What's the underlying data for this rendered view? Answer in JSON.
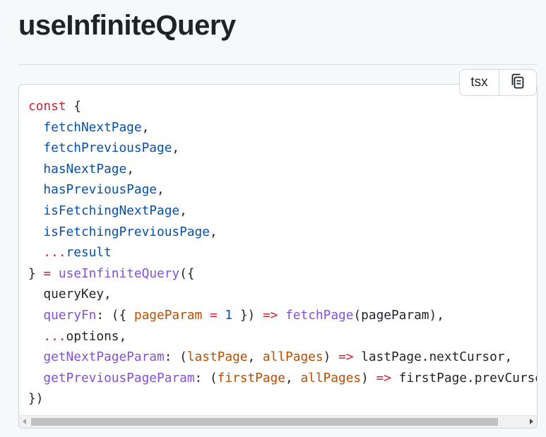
{
  "page": {
    "title": "useInfiniteQuery"
  },
  "code_block": {
    "language": "tsx",
    "copy_icon": "copy-icon",
    "lines": [
      [
        {
          "t": "kw",
          "v": "const"
        },
        {
          "t": "p",
          "v": " {"
        }
      ],
      [
        {
          "t": "p",
          "v": "  "
        },
        {
          "t": "prop",
          "v": "fetchNextPage"
        },
        {
          "t": "p",
          "v": ","
        }
      ],
      [
        {
          "t": "p",
          "v": "  "
        },
        {
          "t": "prop",
          "v": "fetchPreviousPage"
        },
        {
          "t": "p",
          "v": ","
        }
      ],
      [
        {
          "t": "p",
          "v": "  "
        },
        {
          "t": "prop",
          "v": "hasNextPage"
        },
        {
          "t": "p",
          "v": ","
        }
      ],
      [
        {
          "t": "p",
          "v": "  "
        },
        {
          "t": "prop",
          "v": "hasPreviousPage"
        },
        {
          "t": "p",
          "v": ","
        }
      ],
      [
        {
          "t": "p",
          "v": "  "
        },
        {
          "t": "prop",
          "v": "isFetchingNextPage"
        },
        {
          "t": "p",
          "v": ","
        }
      ],
      [
        {
          "t": "p",
          "v": "  "
        },
        {
          "t": "prop",
          "v": "isFetchingPreviousPage"
        },
        {
          "t": "p",
          "v": ","
        }
      ],
      [
        {
          "t": "p",
          "v": "  "
        },
        {
          "t": "kw",
          "v": "..."
        },
        {
          "t": "prop",
          "v": "result"
        }
      ],
      [
        {
          "t": "p",
          "v": "} "
        },
        {
          "t": "kw",
          "v": "="
        },
        {
          "t": "p",
          "v": " "
        },
        {
          "t": "fn",
          "v": "useInfiniteQuery"
        },
        {
          "t": "p",
          "v": "({"
        }
      ],
      [
        {
          "t": "p",
          "v": "  queryKey,"
        }
      ],
      [
        {
          "t": "p",
          "v": "  "
        },
        {
          "t": "fn",
          "v": "queryFn"
        },
        {
          "t": "p",
          "v": ": ({ "
        },
        {
          "t": "param",
          "v": "pageParam"
        },
        {
          "t": "p",
          "v": " "
        },
        {
          "t": "kw",
          "v": "="
        },
        {
          "t": "p",
          "v": " "
        },
        {
          "t": "num",
          "v": "1"
        },
        {
          "t": "p",
          "v": " }) "
        },
        {
          "t": "kw",
          "v": "=>"
        },
        {
          "t": "p",
          "v": " "
        },
        {
          "t": "fn",
          "v": "fetchPage"
        },
        {
          "t": "p",
          "v": "(pageParam),"
        }
      ],
      [
        {
          "t": "p",
          "v": "  "
        },
        {
          "t": "kw",
          "v": "..."
        },
        {
          "t": "p",
          "v": "options,"
        }
      ],
      [
        {
          "t": "p",
          "v": "  "
        },
        {
          "t": "fn",
          "v": "getNextPageParam"
        },
        {
          "t": "p",
          "v": ": ("
        },
        {
          "t": "param",
          "v": "lastPage"
        },
        {
          "t": "p",
          "v": ", "
        },
        {
          "t": "param",
          "v": "allPages"
        },
        {
          "t": "p",
          "v": ") "
        },
        {
          "t": "kw",
          "v": "=>"
        },
        {
          "t": "p",
          "v": " lastPage.nextCursor,"
        }
      ],
      [
        {
          "t": "p",
          "v": "  "
        },
        {
          "t": "fn",
          "v": "getPreviousPageParam"
        },
        {
          "t": "p",
          "v": ": ("
        },
        {
          "t": "param",
          "v": "firstPage"
        },
        {
          "t": "p",
          "v": ", "
        },
        {
          "t": "param",
          "v": "allPages"
        },
        {
          "t": "p",
          "v": ") "
        },
        {
          "t": "kw",
          "v": "=>"
        },
        {
          "t": "p",
          "v": " firstPage.prevCursor,"
        }
      ],
      [
        {
          "t": "p",
          "v": "})"
        }
      ]
    ]
  },
  "colors": {
    "keyword": "#cf222e",
    "property": "#0550ae",
    "function": "#8250df",
    "parameter": "#bc4c00",
    "text": "#1f2328"
  }
}
